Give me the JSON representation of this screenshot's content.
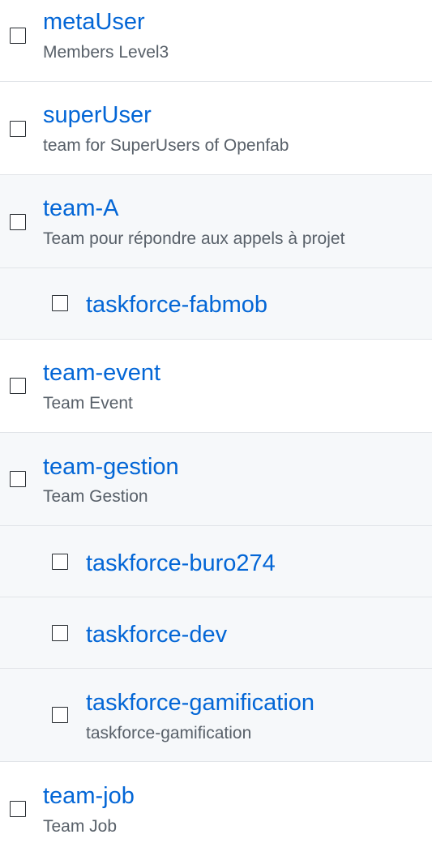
{
  "colors": {
    "link": "#0366d6",
    "description": "#586069",
    "border": "#e1e4e8",
    "alt_background": "#f6f8fa"
  },
  "teams": [
    {
      "name": "metaUser",
      "description": "Members Level3",
      "nested": false
    },
    {
      "name": "superUser",
      "description": "team for SuperUsers of Openfab",
      "nested": false
    },
    {
      "name": "team-A",
      "description": "Team pour répondre aux appels à projet",
      "nested": false
    },
    {
      "name": "taskforce-fabmob",
      "description": "",
      "nested": true
    },
    {
      "name": "team-event",
      "description": "Team Event",
      "nested": false
    },
    {
      "name": "team-gestion",
      "description": "Team Gestion",
      "nested": false
    },
    {
      "name": "taskforce-buro274",
      "description": "",
      "nested": true
    },
    {
      "name": "taskforce-dev",
      "description": "",
      "nested": true
    },
    {
      "name": "taskforce-gamification",
      "description": "taskforce-gamification",
      "nested": true
    },
    {
      "name": "team-job",
      "description": "Team Job",
      "nested": false
    }
  ]
}
